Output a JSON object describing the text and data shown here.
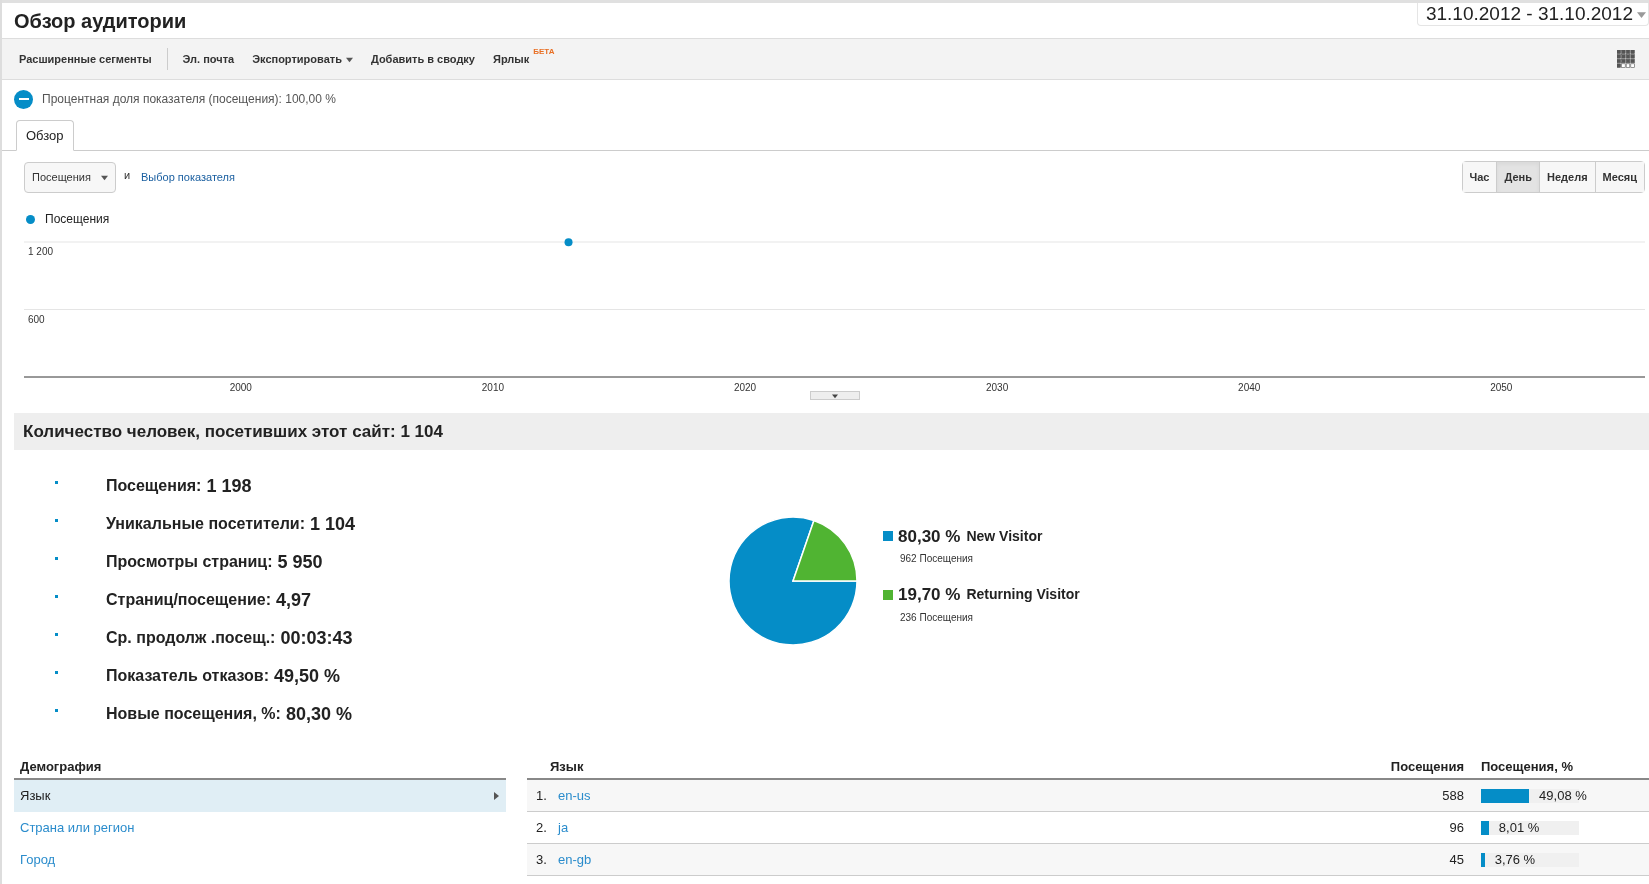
{
  "header": {
    "title": "Обзор аудитории",
    "date_range": "31.10.2012 - 31.10.2012"
  },
  "toolbar": {
    "groups": [
      {
        "items": [
          {
            "label": "Расширенные сегменты",
            "dropdown": false
          }
        ]
      },
      {
        "items": [
          {
            "label": "Эл. почта",
            "dropdown": false
          },
          {
            "label": "Экспортировать",
            "dropdown": true
          },
          {
            "label": "Добавить в сводку",
            "dropdown": false
          },
          {
            "label": "Ярлык",
            "badge": "БЕТА",
            "dropdown": false
          }
        ]
      }
    ]
  },
  "segment": {
    "text": "Процентная доля показателя (посещения): 100,00 %"
  },
  "tabs": [
    {
      "label": "Обзор",
      "selected": true
    }
  ],
  "chart_controls": {
    "metric": "Посещения",
    "conjunction": "и",
    "metric_link": "Выбор показателя",
    "periods": [
      {
        "label": "Час",
        "selected": false
      },
      {
        "label": "День",
        "selected": true
      },
      {
        "label": "Неделя",
        "selected": false
      },
      {
        "label": "Месяц",
        "selected": false
      }
    ]
  },
  "chart": {
    "chart_data": {
      "type": "line",
      "xlim": [
        1991.4,
        2055.7
      ],
      "ylim": [
        0,
        1200
      ],
      "xticks": [
        2000,
        2010,
        2020,
        2030,
        2040,
        2050
      ],
      "yticks": [
        {
          "value": 600,
          "label": "600"
        },
        {
          "value": 1200,
          "label": "1 200"
        }
      ],
      "series": [
        {
          "name": "Посещения",
          "color": "#058dc7",
          "marker": true,
          "values": [
            1198
          ]
        }
      ],
      "x": [
        2013
      ]
    }
  },
  "summary": {
    "title": "Количество человек, посетивших этот сайт: 1 104",
    "stats": [
      {
        "label": "Посещения:",
        "value": "1 198"
      },
      {
        "label": "Уникальные посетители:",
        "value": "1 104"
      },
      {
        "label": "Просмотры страниц:",
        "value": "5 950"
      },
      {
        "label": "Страниц/посещение:",
        "value": "4,97"
      },
      {
        "label": "Ср. продолж .посещ.:",
        "value": "00:03:43"
      },
      {
        "label": "Показатель отказов:",
        "value": "49,50 %"
      },
      {
        "label": "Новые посещения, %:",
        "value": "80,30 %"
      }
    ],
    "pie": {
      "chart_data": {
        "type": "pie",
        "categories": [
          "New Visitor",
          "Returning Visitor"
        ],
        "values": [
          80.3,
          19.7
        ]
      },
      "legend": [
        {
          "percent": "80,30 %",
          "visits": "962 Посещения",
          "color": "#058dc7"
        },
        {
          "percent": "19,70 %",
          "visits": "236 Посещения",
          "color": "#50b432"
        }
      ]
    }
  },
  "demographics": {
    "title": "Демография",
    "items": [
      {
        "label": "Язык",
        "selected": true
      },
      {
        "label": "Страна или регион",
        "selected": false
      },
      {
        "label": "Город",
        "selected": false
      }
    ]
  },
  "table": {
    "columns": [
      "Язык",
      "Посещения",
      "Посещения, %"
    ],
    "rows": [
      {
        "rank": "1.",
        "name": "en-us",
        "visits": "588",
        "percent": "49,08 %",
        "level": 0.4908
      },
      {
        "rank": "2.",
        "name": "ja",
        "visits": "96",
        "percent": "8,01 %",
        "level": 0.0801
      },
      {
        "rank": "3.",
        "name": "en-gb",
        "visits": "45",
        "percent": "3,76 %",
        "level": 0.0376
      }
    ]
  }
}
